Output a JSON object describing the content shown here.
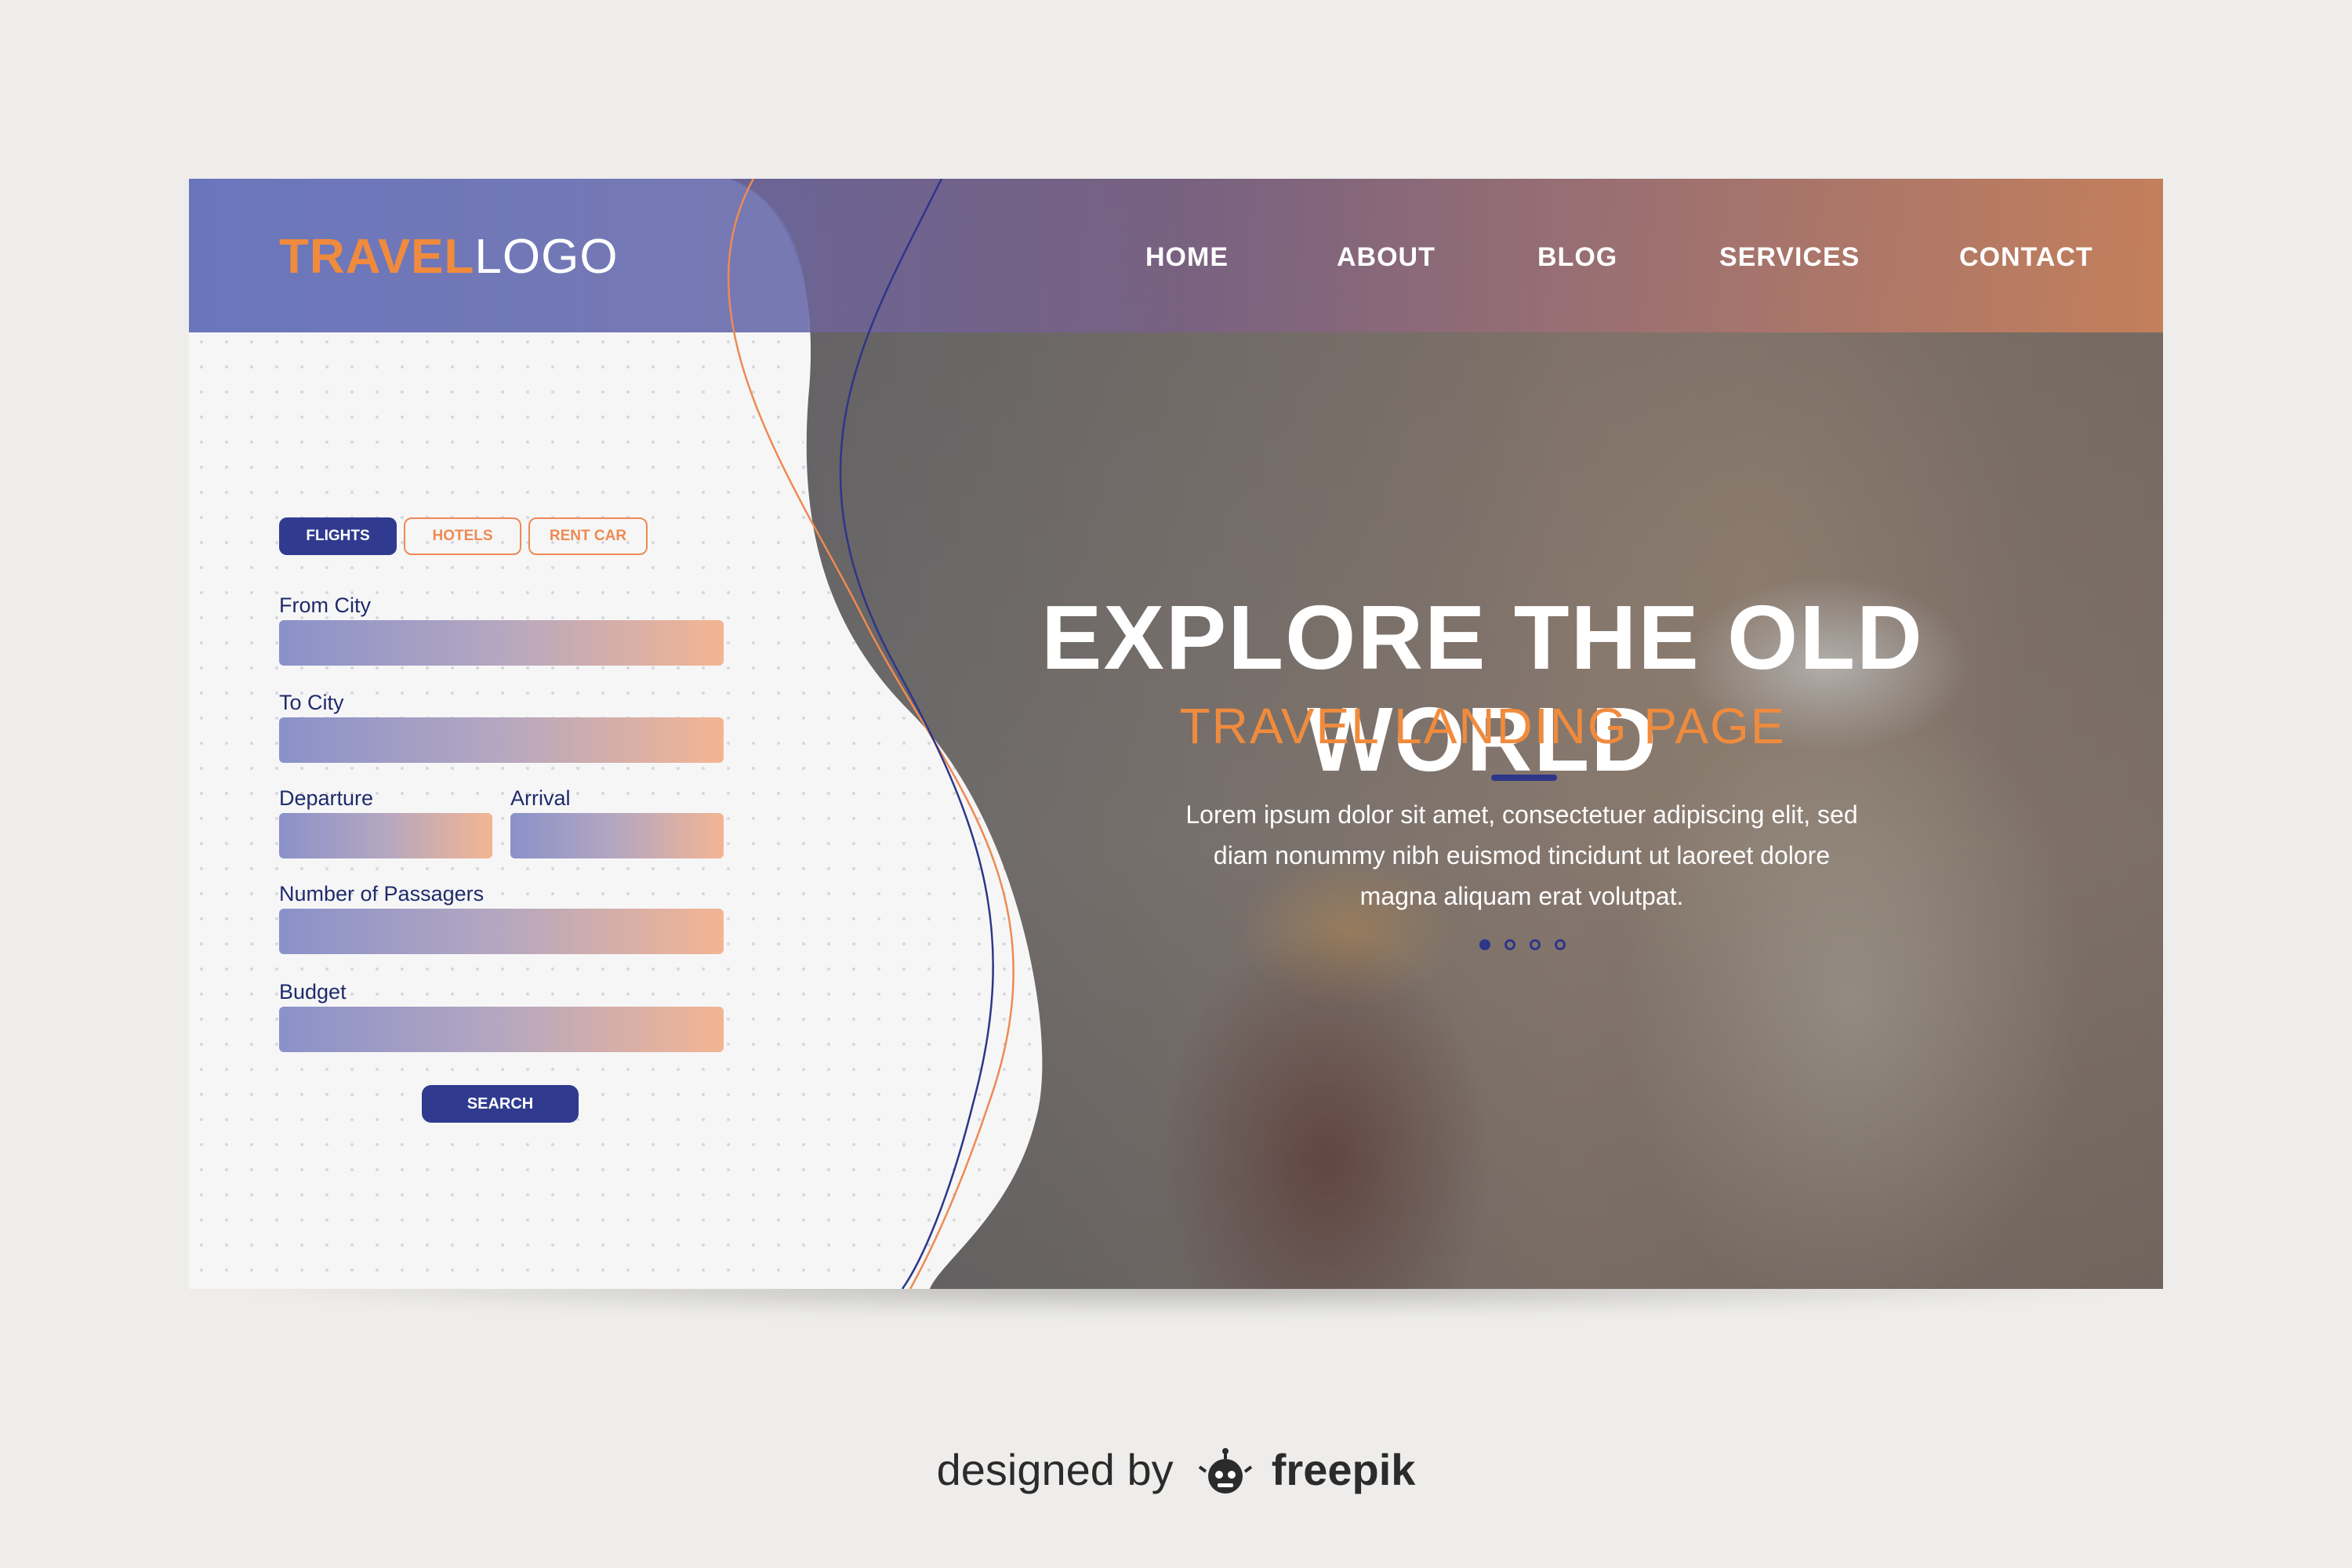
{
  "logo": {
    "part1": "TRAVEL",
    "part2": "LOGO"
  },
  "nav": {
    "items": [
      {
        "label": "HOME"
      },
      {
        "label": "ABOUT"
      },
      {
        "label": "BLOG"
      },
      {
        "label": "SERVICES"
      },
      {
        "label": "CONTACT"
      }
    ]
  },
  "search_form": {
    "tabs": [
      {
        "label": "FLIGHTS",
        "active": true
      },
      {
        "label": "HOTELS",
        "active": false
      },
      {
        "label": "RENT CAR",
        "active": false
      }
    ],
    "fields": {
      "from_city": "From City",
      "to_city": "To City",
      "departure": "Departure",
      "arrival": "Arrival",
      "passengers": "Number of Passagers",
      "budget": "Budget"
    },
    "search_label": "SEARCH"
  },
  "hero": {
    "title": "EXPLORE THE OLD WORLD",
    "subtitle": "TRAVEL LANDING PAGE",
    "body": "Lorem ipsum dolor sit amet, consectetuer adipiscing elit, sed diam nonummy nibh euismod tincidunt ut laoreet dolore magna aliquam erat volutpat.",
    "slider": {
      "count": 4,
      "active_index": 0
    }
  },
  "credit": {
    "prefix": "designed by",
    "brand": "freepik"
  },
  "colors": {
    "accent_orange": "#f08b3d",
    "primary_navy": "#303b8f",
    "header_gradient_start": "#5a6cbd",
    "header_gradient_end": "#d4845a"
  }
}
